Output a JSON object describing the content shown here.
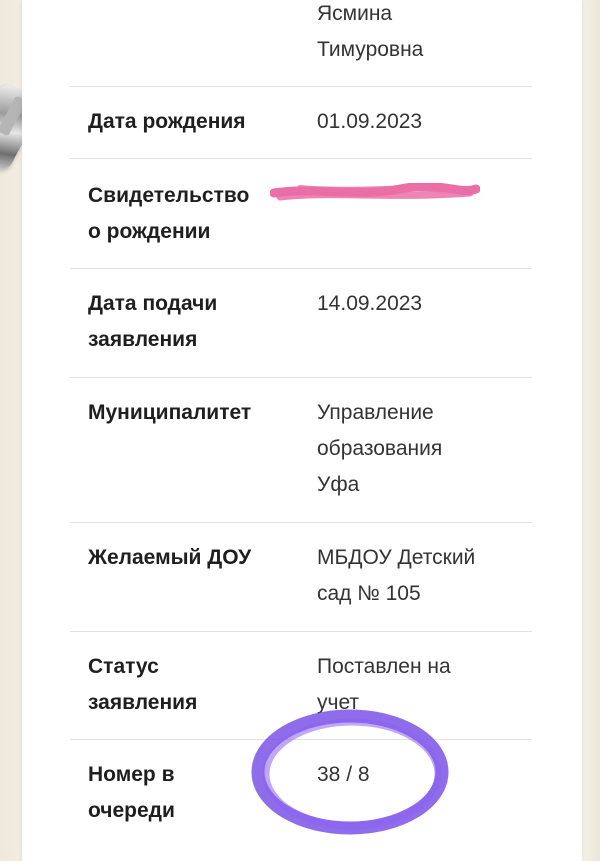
{
  "name": {
    "value": "Ясмина\nТимуровна"
  },
  "fields": [
    {
      "label": "Дата рождения",
      "value": "01.09.2023"
    },
    {
      "label": "Свидетельство\nо рождении",
      "value": ""
    },
    {
      "label": "Дата подачи\nзаявления",
      "value": "14.09.2023"
    },
    {
      "label": "Муниципалитет",
      "value": "Управление\nобразования\nУфа"
    },
    {
      "label": "Желаемый ДОУ",
      "value": "МБДОУ Детский\nсад № 105"
    },
    {
      "label": "Статус\nзаявления",
      "value": "Поставлен на\nучет"
    },
    {
      "label": "Номер в\nочереди",
      "value": "38 / 8"
    }
  ],
  "colors": {
    "redaction": "#ea6fa6",
    "circle_marker": "#7b52e6"
  }
}
